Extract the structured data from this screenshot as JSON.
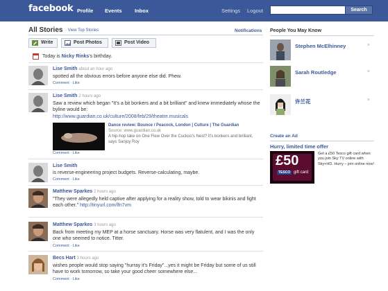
{
  "topbar": {
    "logo": "facebook",
    "nav": [
      "Profile",
      "Events",
      "Inbox"
    ],
    "right_links": [
      "Settings",
      "Logout"
    ],
    "search_button": "Search",
    "search_placeholder": ""
  },
  "feed": {
    "title": "All Stories",
    "view_top": "· View Top Stories",
    "notifications": "Notifications",
    "publish_buttons": [
      "Write",
      "Post Photos",
      "Post Video"
    ],
    "birthday": {
      "prefix": "Today is ",
      "name": "Nicky Rinks",
      "suffix": "'s birthday."
    },
    "stories": [
      {
        "name": "Lise Smith",
        "time": "about an hour ago",
        "text": "spotted all the obvious errors before anyone else did. Phew.",
        "actions": "Comment · Like"
      },
      {
        "name": "Lise Smith",
        "time": "2 hours ago",
        "text": "Saw a review which began \"It's a bit bonkers and a bit brilliant\" and knew immediately whose the byline would be:",
        "link": "http://www.guardian.co.uk/culture/2008/feb/29/theatre.musicals",
        "attachment": {
          "title": "Dance review: Bounce / Peacock, London | Culture | The Guardian",
          "source": "Source: www.guardian.co.uk",
          "description": "A hip-hop take on One Flew Over the Cuckoo's Nest? It's bonkers and brilliant, says Sanjoy Roy"
        },
        "actions": "Comment · Like"
      },
      {
        "name": "Lise Smith",
        "time": "2 hours ago",
        "text": "is reverse-engineering project budgets. Reverse-calculating, maybe.",
        "actions": "Comment · Like"
      },
      {
        "name": "Matthew Sparkes",
        "time": "2 hours ago",
        "text": "\"They were allegedly held captive after applying for a reality show, told to wear bikinis and fight each other.\"",
        "link": "http://tinyurl.com/lfn7vm",
        "actions": "Comment · Like"
      },
      {
        "name": "Matthew Sparkes",
        "time": "3 hours ago",
        "text": "Back from meeting my MEP at a horse sanctuary. Horse was very flatulent, and I was the only one who seemed to notice. Titter.",
        "actions": "Comment · Like"
      },
      {
        "name": "Becs Hart",
        "time": "3 hours ago",
        "text": "wishes people would stop saying \"hurray it's Friday\"...yes it might be Friday but some of us still have to work tomorrow, so take your good cheer somewhere else...",
        "actions": "Comment · Like"
      }
    ]
  },
  "sidebar": {
    "pymk_title": "People You May Know",
    "people": [
      {
        "name": "Stephen McElhinney",
        "dismiss": "×"
      },
      {
        "name": "Sarah Routledge",
        "dismiss": "×"
      },
      {
        "name": "许兰花",
        "dismiss": "×"
      }
    ],
    "create_ad": "Create an Ad",
    "ad": {
      "title": "Hurry, limited time offer",
      "image_big": "£50",
      "image_brand": "TESCO",
      "image_caption": "gift card",
      "text": "Get a £50 Tesco gift card when you join Sky TV online with Sky+HD. Hurry – join online now!"
    }
  },
  "colors": {
    "brand": "#3b5998",
    "text": "#333333",
    "divider": "#d8dfea"
  }
}
